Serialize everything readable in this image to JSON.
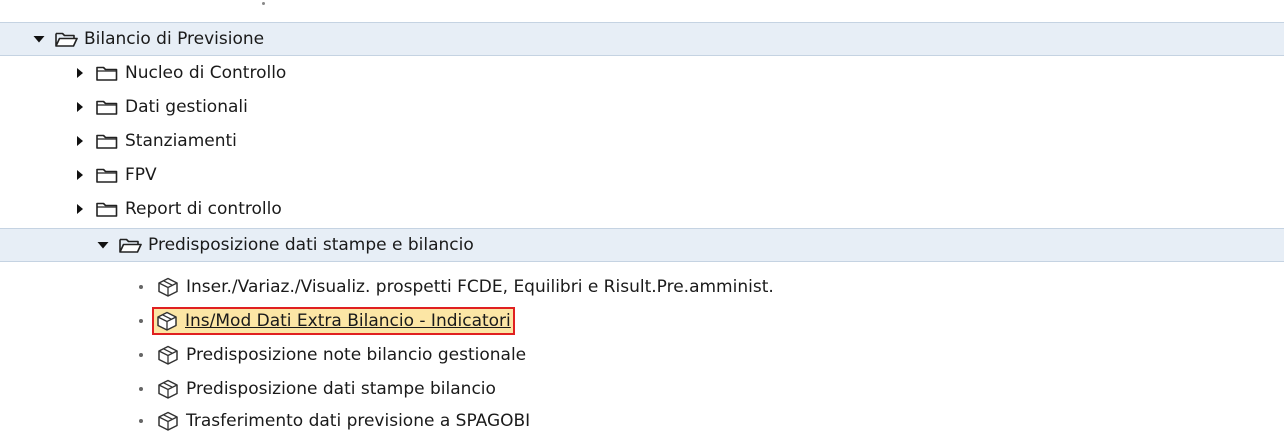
{
  "tree": {
    "root": {
      "label": "Bilancio di Previsione",
      "expanded": true,
      "icon": "folder-open-icon"
    },
    "folders": [
      {
        "label": "Nucleo di Controllo",
        "expanded": false,
        "icon": "folder-icon"
      },
      {
        "label": "Dati gestionali",
        "expanded": false,
        "icon": "folder-icon"
      },
      {
        "label": "Stanziamenti",
        "expanded": false,
        "icon": "folder-icon"
      },
      {
        "label": "FPV",
        "expanded": false,
        "icon": "folder-icon"
      },
      {
        "label": "Report di controllo",
        "expanded": false,
        "icon": "folder-icon"
      },
      {
        "label": "Predisposizione dati stampe e bilancio",
        "expanded": true,
        "icon": "folder-open-icon"
      }
    ],
    "transactions": [
      {
        "label": "Inser./Variaz./Visualiz. prospetti FCDE, Equilibri e Risult.Pre.amminist.",
        "selected": false,
        "icon": "cube-icon"
      },
      {
        "label": "Ins/Mod Dati Extra Bilancio - Indicatori",
        "selected": true,
        "icon": "cube-icon"
      },
      {
        "label": "Predisposizione note bilancio gestionale",
        "selected": false,
        "icon": "cube-icon"
      },
      {
        "label": "Predisposizione dati stampe bilancio",
        "selected": false,
        "icon": "cube-icon"
      },
      {
        "label": "Trasferimento dati previsione a SPAGOBI",
        "selected": false,
        "icon": "cube-icon"
      }
    ]
  },
  "colors": {
    "band": "#e7eef6",
    "selection_fill": "#fce6a5",
    "selection_border": "#e02020"
  }
}
